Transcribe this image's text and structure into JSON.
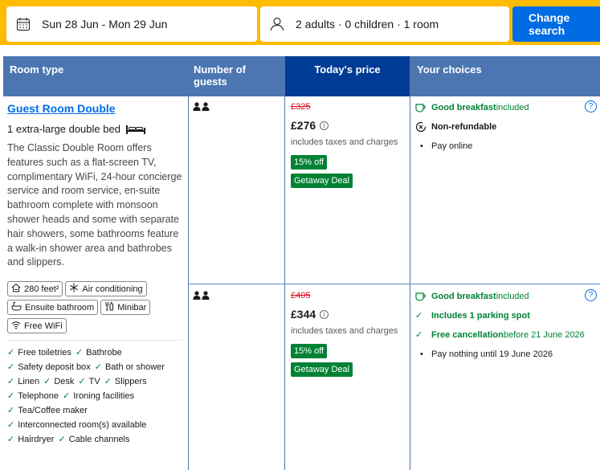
{
  "search": {
    "dates": "Sun 28 Jun - Mon 29 Jun",
    "guests": "2 adults · 0 children · 1 room",
    "button": "Change search",
    "calendar_icon": "calendar-icon",
    "person_icon": "person-icon"
  },
  "table": {
    "headers": {
      "room_type": "Room type",
      "guests": "Number of guests",
      "price": "Today's price",
      "choices": "Your choices"
    }
  },
  "room": {
    "name": "Guest Room Double",
    "bed": "1 extra-large double bed",
    "description": "The Classic Double Room offers features such as a flat-screen TV, complimentary WiFi, 24-hour concierge service and room service, en-suite bathroom complete with monsoon shower heads and some with separate hair showers, some bathrooms feature a walk-in shower area and bathrobes and slippers.",
    "facilities": [
      {
        "label": "280 feet²",
        "icon": "room-size-icon"
      },
      {
        "label": "Air conditioning",
        "icon": "snowflake-icon"
      },
      {
        "label": "Ensuite bathroom",
        "icon": "bath-icon"
      },
      {
        "label": "Minibar",
        "icon": "minibar-icon"
      },
      {
        "label": "Free WiFi",
        "icon": "wifi-icon"
      }
    ],
    "amenities": [
      [
        "Free toiletries",
        "Bathrobe"
      ],
      [
        "Safety deposit box",
        "Bath or shower"
      ],
      [
        "Linen",
        "Desk",
        "TV",
        "Slippers"
      ],
      [
        "Telephone",
        "Ironing facilities"
      ],
      [
        "Tea/Coffee maker"
      ],
      [
        "Interconnected room(s) available"
      ],
      [
        "Hairdryer",
        "Cable channels"
      ]
    ]
  },
  "options": [
    {
      "old_price": "£325",
      "price": "£276",
      "tax_note": "includes taxes and charges",
      "discount": "15% off",
      "deal": "Getaway Deal",
      "choices": {
        "breakfast_bold": "Good breakfast",
        "breakfast_rest": " included",
        "refund": "Non-refundable",
        "payment": "Pay online"
      }
    },
    {
      "old_price": "£405",
      "price": "£344",
      "tax_note": "includes taxes and charges",
      "discount": "15% off",
      "deal": "Getaway Deal",
      "choices": {
        "breakfast_bold": "Good breakfast",
        "breakfast_rest": " included",
        "parking": "Includes 1 parking spot",
        "cancel_bold": "Free cancellation",
        "cancel_rest": " before 21 June 2026",
        "payment": "Pay nothing until 19 June 2026"
      }
    }
  ],
  "colors": {
    "header_blue": "#4c76b2",
    "price_header": "#003b95",
    "green": "#008234",
    "link": "#006ce4",
    "strike_red": "#d4111e",
    "search_yellow": "#febb02"
  }
}
